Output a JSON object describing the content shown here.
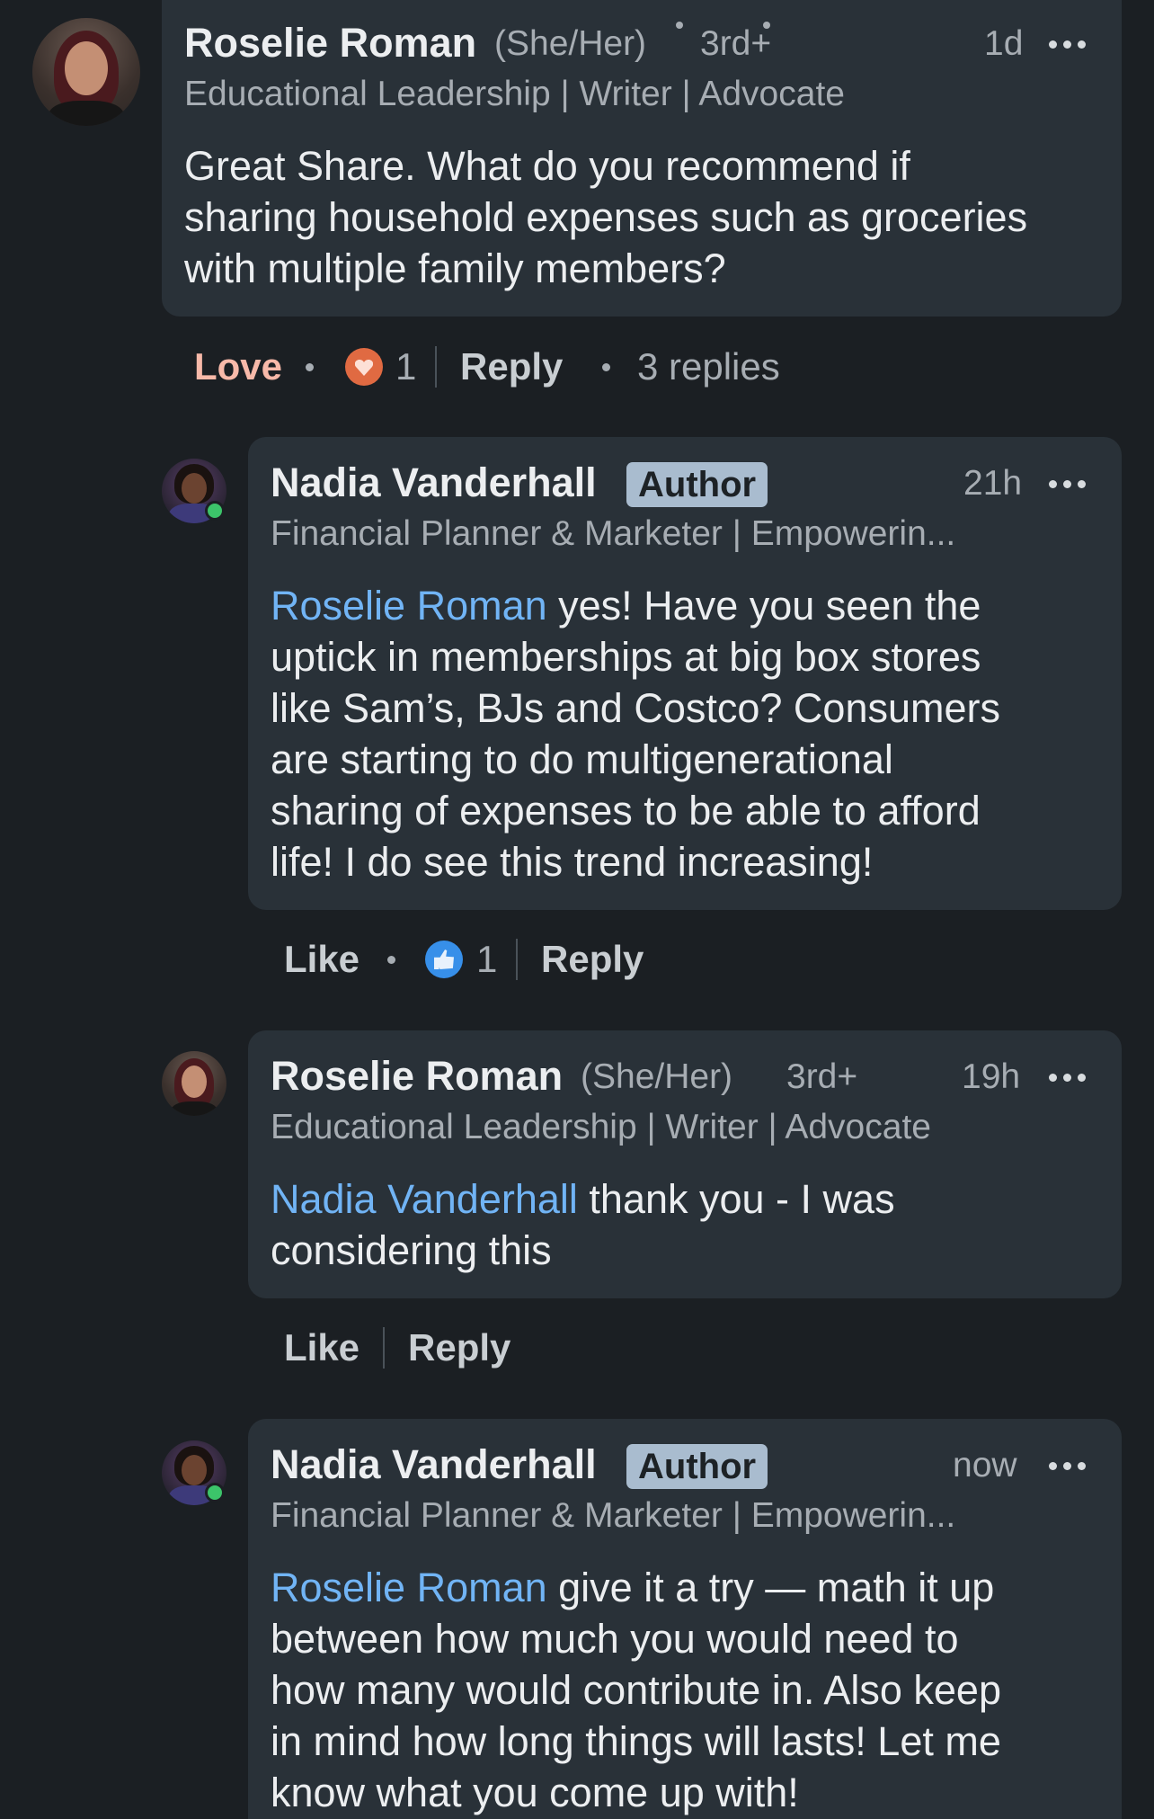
{
  "comments": [
    {
      "name": "Roselie Roman",
      "pronoun": "(She/Her)",
      "degree": "3rd+",
      "headline": "Educational Leadership | Writer | Advocate",
      "time": "1d",
      "text": [
        "Great Share. What do you recommend if",
        "sharing household expenses such as groceries",
        "with multiple family members?"
      ],
      "reaction_label": "Love",
      "reaction_count": "1",
      "reply_label": "Reply",
      "replies_count": "3 replies"
    }
  ],
  "replies": [
    {
      "name": "Nadia Vanderhall",
      "badge": "Author",
      "headline": "Financial Planner & Marketer | Empowerin...",
      "time": "21h",
      "mention": "Roselie Roman",
      "first_line_rest": " yes! Have you seen the",
      "lines": [
        "uptick in memberships at big box stores",
        "like Sam’s, BJs and Costco? Consumers",
        "are starting to do multigenerational",
        "sharing of expenses to be able to afford",
        "life! I do see this trend increasing!"
      ],
      "like_label": "Like",
      "reaction_count": "1",
      "reply_label": "Reply"
    },
    {
      "name": "Roselie Roman",
      "pronoun": "(She/Her)",
      "degree": "3rd+",
      "headline": "Educational Leadership | Writer | Advocate",
      "time": "19h",
      "mention": "Nadia Vanderhall",
      "first_line_rest": " thank you - I was",
      "lines": [
        "considering this"
      ],
      "like_label": "Like",
      "reply_label": "Reply"
    },
    {
      "name": "Nadia Vanderhall",
      "badge": "Author",
      "headline": "Financial Planner & Marketer | Empowerin...",
      "time": "now",
      "mention": "Roselie Roman",
      "first_line_rest": " give it a try — math it up",
      "lines": [
        "between how much you would need to",
        "how many would contribute in. Also keep",
        "in mind how long things will lasts! Let me",
        "know what you come up with!"
      ]
    }
  ],
  "colors": {
    "background": "#1b1f23",
    "bubble": "#293138",
    "mention": "#71b4f5",
    "love": "#f7b9a9",
    "author_badge": "#a9bccf",
    "online": "#3cc46a"
  }
}
